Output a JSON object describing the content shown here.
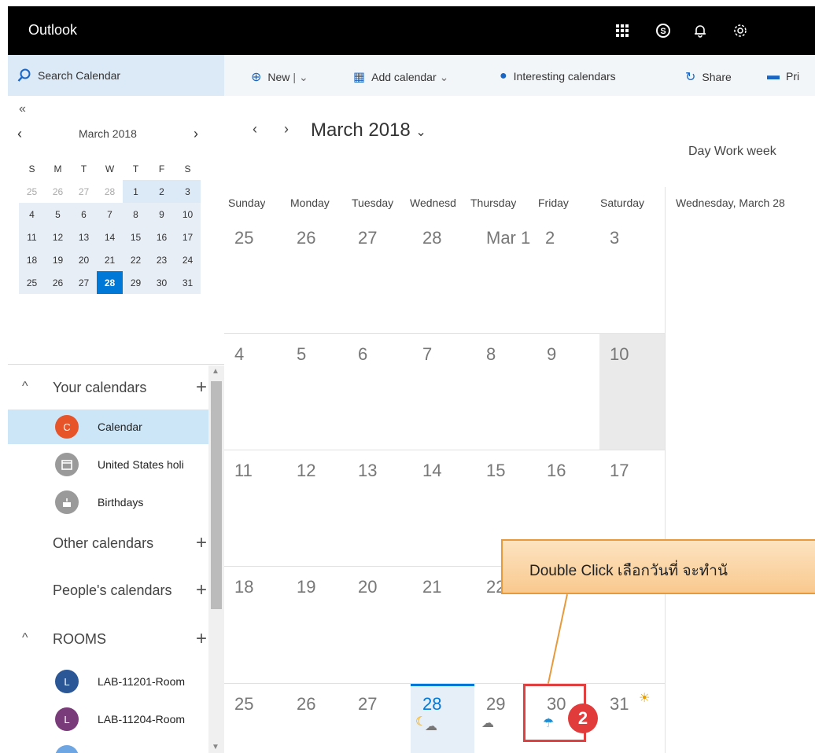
{
  "app": {
    "title": "Outlook"
  },
  "topbar_icons": [
    {
      "name": "app-launcher-icon",
      "glyph": "▦"
    },
    {
      "name": "skype-icon",
      "glyph": "Ⓢ"
    },
    {
      "name": "notifications-icon",
      "glyph": "🔔"
    },
    {
      "name": "settings-icon",
      "glyph": "⚙"
    }
  ],
  "search": {
    "label": "Search Calendar"
  },
  "mini_calendar": {
    "collapse": "«",
    "month": "March 2018",
    "prev": "<",
    "next": ">",
    "weekday_headers": [
      "S",
      "M",
      "T",
      "W",
      "T",
      "F",
      "S"
    ],
    "weeks": [
      [
        "25",
        "26",
        "27",
        "28",
        "1",
        "2",
        "3"
      ],
      [
        "4",
        "5",
        "6",
        "7",
        "8",
        "9",
        "10"
      ],
      [
        "11",
        "12",
        "13",
        "14",
        "15",
        "16",
        "17"
      ],
      [
        "18",
        "19",
        "20",
        "21",
        "22",
        "23",
        "24"
      ],
      [
        "25",
        "26",
        "27",
        "28",
        "29",
        "30",
        "31"
      ]
    ],
    "selected_day": "28"
  },
  "calendars": {
    "your_calendars": "Your calendars",
    "items": [
      {
        "initial": "C",
        "label": "Calendar",
        "color": "#e8542a"
      },
      {
        "initial": "▭",
        "label": "United States holi",
        "color": "#9a9a9a"
      },
      {
        "initial": "⌂",
        "label": "Birthdays",
        "color": "#9a9a9a"
      }
    ],
    "other_calendars": "Other calendars",
    "peoples_calendars": "People's calendars",
    "rooms_header": "ROOMS",
    "rooms": [
      {
        "initial": "L",
        "label": "LAB-11201-Room",
        "color": "#2b5797"
      },
      {
        "initial": "L",
        "label": "LAB-11204-Room",
        "color": "#7a3b7a"
      }
    ]
  },
  "toolbar": {
    "new_label": "New",
    "add_calendar_label": "Add calendar",
    "interesting_label": "Interesting calendars",
    "share_label": "Share",
    "print_label": "Pri"
  },
  "calendar": {
    "title": "March 2018",
    "views": "Day  Work week",
    "weekdays": [
      "Sunday",
      "Monday",
      "Tuesday",
      "Wednesd",
      "Thursday",
      "Friday",
      "Saturday"
    ],
    "weeks": [
      [
        "25",
        "26",
        "27",
        "28",
        "Mar 1",
        "2",
        "3"
      ],
      [
        "4",
        "5",
        "6",
        "7",
        "8",
        "9",
        "10"
      ],
      [
        "11",
        "12",
        "13",
        "14",
        "15",
        "16",
        "17"
      ],
      [
        "18",
        "19",
        "20",
        "21",
        "22",
        "",
        ""
      ],
      [
        "25",
        "26",
        "27",
        "28",
        "29",
        "30",
        "31"
      ]
    ],
    "agenda_title": "Wednesday, March 28"
  },
  "callout": {
    "text": "Double Click เลือกวันที่ จะทำนั",
    "badge": "2"
  }
}
